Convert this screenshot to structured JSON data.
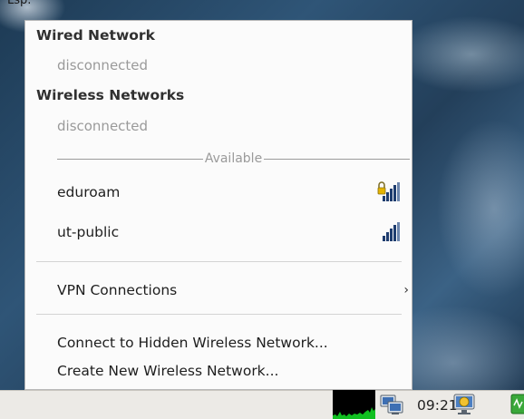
{
  "top_text": "Lsp.",
  "menu": {
    "wired_header": "Wired Network",
    "wired_status": "disconnected",
    "wireless_header": "Wireless Networks",
    "wireless_status": "disconnected",
    "available_label": "Available",
    "networks": [
      {
        "name": "eduroam",
        "secured": true,
        "signal_icon": "wifi-signal-lock-icon"
      },
      {
        "name": "ut-public",
        "secured": false,
        "signal_icon": "wifi-signal-icon"
      }
    ],
    "vpn_label": "VPN Connections",
    "vpn_arrow": "›",
    "connect_hidden_label": "Connect to Hidden Wireless Network...",
    "create_new_label": "Create New Wireless Network..."
  },
  "taskbar": {
    "clock": "09:21",
    "icons": [
      "network-graph-icon",
      "network-computers-icon",
      "update-notifier-icon",
      "app-icon"
    ]
  },
  "colors": {
    "signal_bars": "#1e3c6e",
    "lock": "#e4b400",
    "netgraph": "#10c020"
  }
}
